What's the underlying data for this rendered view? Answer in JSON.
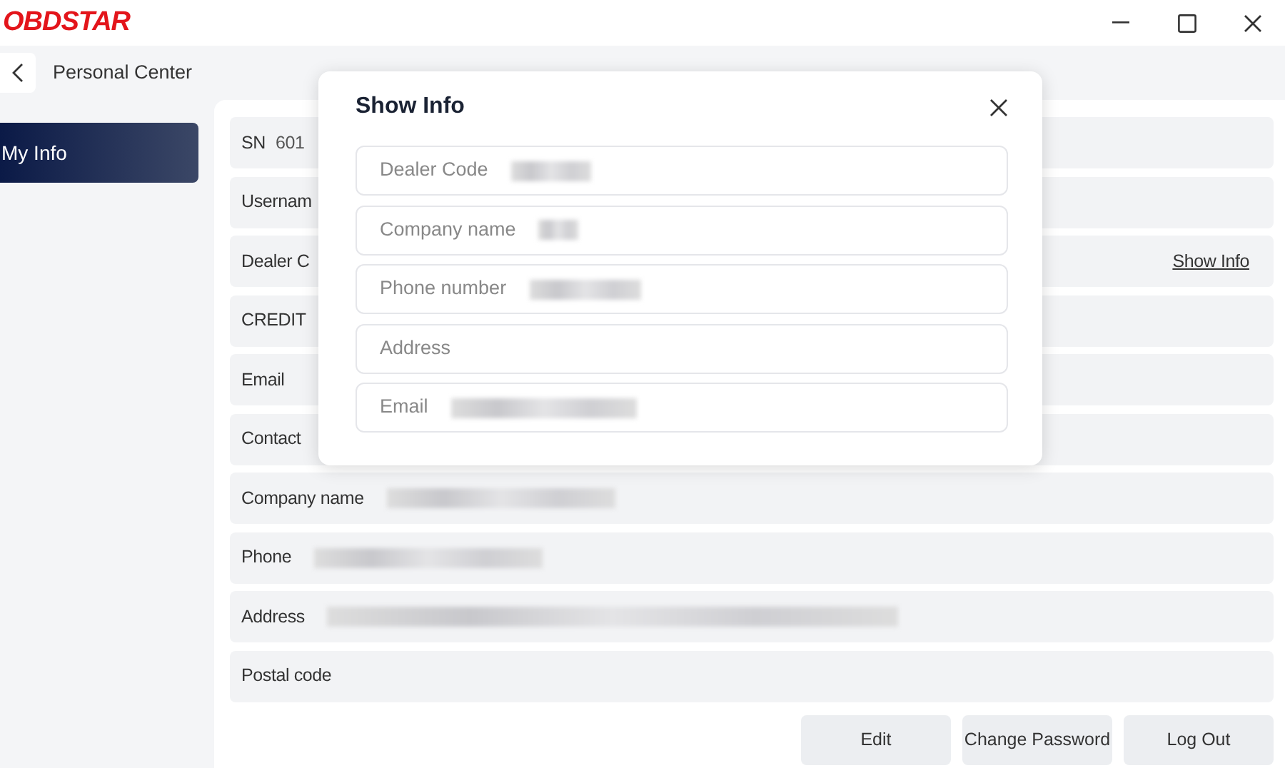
{
  "window": {
    "logo": "OBDSTAR"
  },
  "header": {
    "title": "Personal Center"
  },
  "sidebar": {
    "items": [
      {
        "label": "My Info",
        "selected": true
      }
    ]
  },
  "info_rows": [
    {
      "label": "SN",
      "value": "601"
    },
    {
      "label": "Usernam"
    },
    {
      "label": "Dealer C",
      "link": "Show Info"
    },
    {
      "label": "CREDIT"
    },
    {
      "label": "Email"
    },
    {
      "label": "Contact"
    },
    {
      "label": "Company name",
      "redacted": true
    },
    {
      "label": "Phone",
      "redacted": true
    },
    {
      "label": "Address",
      "redacted": true
    },
    {
      "label": "Postal code"
    }
  ],
  "buttons": [
    "Edit",
    "Change Password",
    "Log Out"
  ],
  "dialog": {
    "title": "Show Info",
    "fields": [
      {
        "label": "Dealer Code",
        "redacted": true
      },
      {
        "label": "Company name",
        "redacted": true
      },
      {
        "label": "Phone number",
        "redacted": true
      },
      {
        "label": "Address",
        "redacted": false
      },
      {
        "label": "Email",
        "redacted": true
      }
    ]
  }
}
